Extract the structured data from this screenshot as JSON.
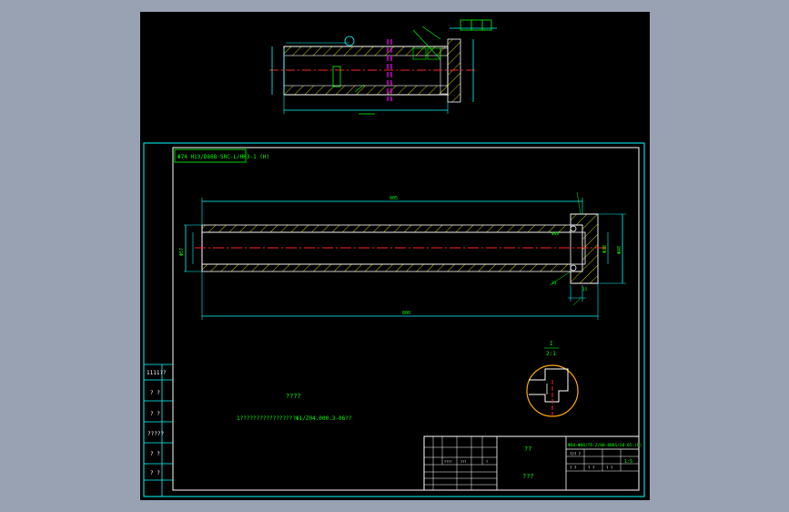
{
  "app": {
    "window_title": ""
  },
  "colors": {
    "background": "#98a2b3",
    "paper": "#000000",
    "geometry": "#ffffff",
    "dimension": "#00ffff",
    "text": "#00ff00",
    "centerline": "#ff2020",
    "hatch": "#ffff00",
    "section_line": "#ff00ff",
    "detail_circle": "#ffaa00"
  },
  "frame": {
    "header_note": "Φ74 H13/D868 SRC-L/HH3-1 (H)",
    "left_column": [
      "1111??",
      "? ?",
      "? ?",
      "?????",
      "? ?",
      "? ?"
    ]
  },
  "main_view": {
    "dim_top": "905",
    "dim_bottom": "800",
    "dim_left": "Φ57",
    "dim_right": "Φ48",
    "dim_inner_right": "Φ38",
    "dim_small": "15",
    "dim_small2": "33"
  },
  "detail": {
    "label_top": "I",
    "label_scale": "2:1"
  },
  "notes": {
    "title": "????",
    "line": "1?????????????????Φ1/Z04.000.3-06??"
  },
  "title_block": {
    "drawing_number": "Φ60-Φ00/TR-Z/00-800S/20-05.(R)",
    "center_top": "??",
    "center_bottom": "???",
    "scale": "1:5",
    "row_labels": [
      "??? ?",
      "? ?",
      "? ?",
      "? ?"
    ],
    "left_grid": [
      "????",
      "???",
      "?"
    ]
  }
}
